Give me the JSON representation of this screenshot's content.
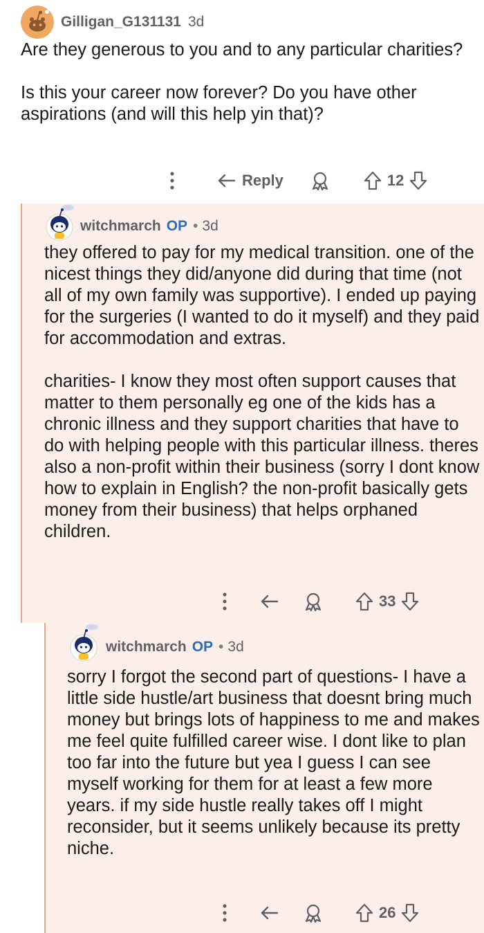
{
  "comments": [
    {
      "username": "Gilligan_G131131",
      "op": "",
      "age": "3d",
      "text": "Are they generous to you and to any particular charities?\n\nIs this your career now forever? Do you have other aspirations (and will this help yin that)?",
      "reply_label": "Reply",
      "votes": "12"
    },
    {
      "username": "witchmarch",
      "op": "OP",
      "dot": "•",
      "age": "3d",
      "text": "they offered to pay for my medical transition. one of the nicest things they did/anyone did during that time (not all of my own family was supportive). I ended up paying for the surgeries (I wanted to do it myself) and they paid for accommodation and extras.\n\ncharities- I know they most often support causes that matter to them personally eg one of the kids has a chronic illness and they support charities that have to do with helping people with this particular illness. theres also a non-profit within their business (sorry I dont know how to explain in English? the non-profit basically gets money from their business) that helps orphaned children.",
      "votes": "33"
    },
    {
      "username": "witchmarch",
      "op": "OP",
      "dot": "•",
      "age": "3d",
      "text": "sorry I forgot the second part of questions- I have a little side hustle/art business that doesnt bring much money but brings lots of happiness to me and makes me feel quite fulfilled career wise. I dont like to plan too far into the future but yea I guess I can see myself working for them for at least a few more years. if my side hustle really takes off I might reconsider, but it seems unlikely because its pretty niche.",
      "votes": "26"
    }
  ],
  "colors": {
    "thread_background": "#fcefe9",
    "thread_line": "#e8a58a",
    "op_tag": "#2a6fb8",
    "meta_text": "#5e6064",
    "body_text": "#1a1a1b",
    "avatar_orange": "#f0a761"
  },
  "icons": [
    "reddit-snoo-avatar",
    "custom-snoo-avatar",
    "more-options-icon",
    "reply-arrow-icon",
    "award-icon",
    "upvote-icon",
    "downvote-icon"
  ]
}
